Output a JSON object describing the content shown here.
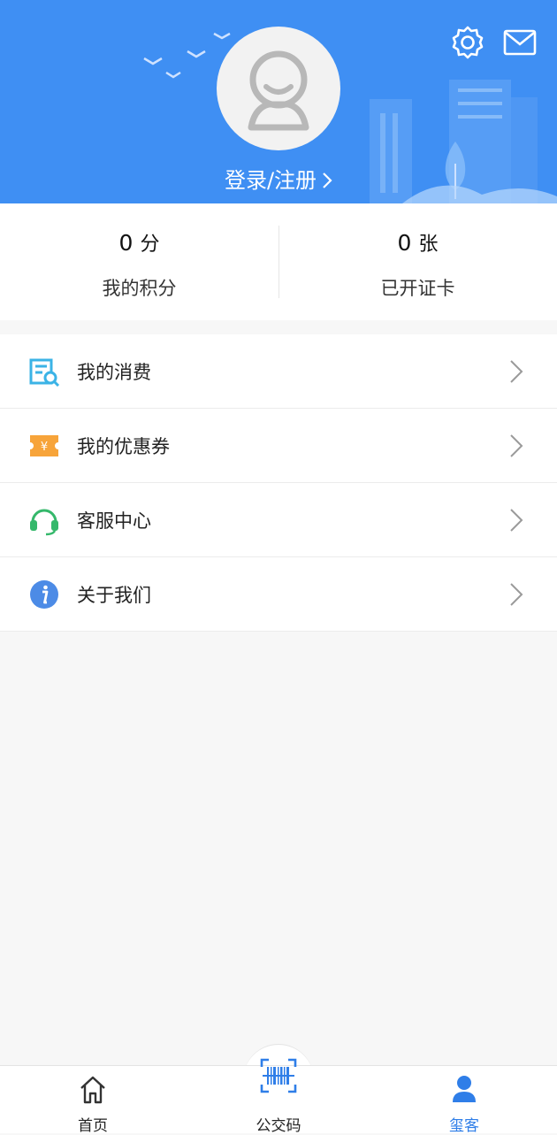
{
  "header": {
    "login_label": "登录/注册",
    "background_color": "#3f8ff3",
    "icons": [
      "settings-icon",
      "mail-icon"
    ]
  },
  "stats": [
    {
      "value": "0",
      "unit": "分",
      "label": "我的积分"
    },
    {
      "value": "0",
      "unit": "张",
      "label": "已开证卡"
    }
  ],
  "menu": [
    {
      "label": "我的消费",
      "icon": "receipt-icon",
      "color": "#3bb3e6"
    },
    {
      "label": "我的优惠券",
      "icon": "coupon-icon",
      "color": "#f7a43a"
    },
    {
      "label": "客服中心",
      "icon": "headset-icon",
      "color": "#35b86b"
    },
    {
      "label": "关于我们",
      "icon": "info-icon",
      "color": "#4c8be6"
    }
  ],
  "tabbar": {
    "items": [
      {
        "label": "首页",
        "icon": "home-icon",
        "active": false
      },
      {
        "label": "公交码",
        "icon": "barcode-scan-icon",
        "active": false
      },
      {
        "label": "玺客",
        "icon": "user-icon",
        "active": true
      }
    ],
    "active_color": "#2f7ee8"
  }
}
